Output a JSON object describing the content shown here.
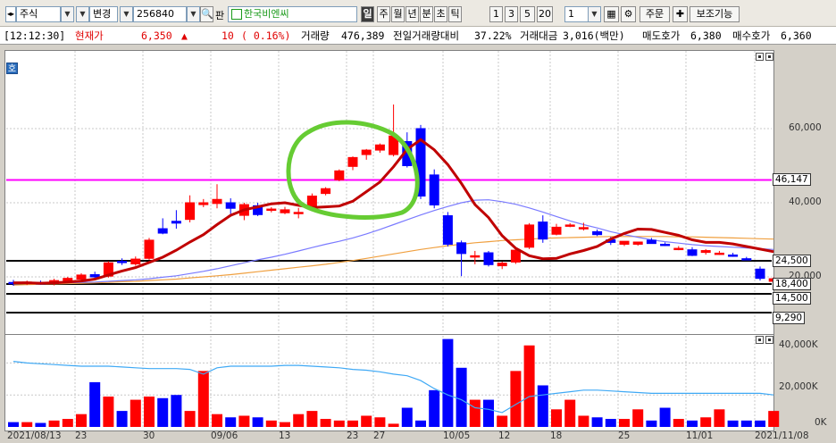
{
  "toolbar": {
    "market_type": "주식",
    "change_label": "변경",
    "stock_code": "256840",
    "board_label": "판",
    "stock_name": "한국비엔씨",
    "periods": [
      "일",
      "주",
      "월",
      "년",
      "분",
      "초",
      "틱"
    ],
    "active_period": "일",
    "intervals": [
      "1",
      "3",
      "5",
      "20"
    ],
    "interval_value": "1",
    "order_label": "주문",
    "aux_label": "보조기능"
  },
  "info": {
    "time": "[12:12:30]",
    "price_label": "현재가",
    "price": "6,350",
    "change_arrow": "▲",
    "change": "10",
    "change_pct": "( 0.16%)",
    "volume_label": "거래량",
    "volume": "476,389",
    "prev_volume_ratio_label": "전일거래량대비",
    "prev_volume_ratio": "37.22%",
    "trade_value_label": "거래대금",
    "trade_value": "3,016(백만)",
    "ask_label": "매도호가",
    "ask": "6,380",
    "bid_label": "매수호가",
    "bid": "6,360"
  },
  "chart_side_label": "호",
  "price_axis": [
    "60,000",
    "40,000",
    "20,000"
  ],
  "volume_axis": [
    "40,000K",
    "20,000K",
    "0K"
  ],
  "x_labels": [
    "2021/08/13",
    "23",
    "30",
    "09/06",
    "13",
    "23",
    "27",
    "10/05",
    "12",
    "18",
    "25",
    "11/01",
    "2021/11/08"
  ],
  "level_tags": [
    "46,147",
    "24,500",
    "18,400",
    "14,500",
    "9,290"
  ],
  "colors": {
    "up": "#ff0000",
    "down": "#0000ff",
    "ma5": "#c00000",
    "ma20": "#7a7aff",
    "ma60": "#f0a040",
    "magenta_line": "#ff00ff",
    "highlight_circle": "#66cc33",
    "vol_ma": "#3fa9f5"
  },
  "chart_data": {
    "type": "candlestick",
    "candles": [
      {
        "o": 18.5,
        "h": 19.2,
        "l": 17.6,
        "c": 18.2
      },
      {
        "o": 18.3,
        "h": 19.0,
        "l": 17.8,
        "c": 18.6
      },
      {
        "o": 18.4,
        "h": 19.0,
        "l": 17.9,
        "c": 18.1
      },
      {
        "o": 18.2,
        "h": 19.5,
        "l": 17.7,
        "c": 19.0
      },
      {
        "o": 19.0,
        "h": 20.0,
        "l": 18.6,
        "c": 19.6
      },
      {
        "o": 19.4,
        "h": 21.0,
        "l": 19.0,
        "c": 20.5
      },
      {
        "o": 20.6,
        "h": 21.4,
        "l": 19.7,
        "c": 20.0
      },
      {
        "o": 20.2,
        "h": 24.2,
        "l": 19.8,
        "c": 23.8
      },
      {
        "o": 24.2,
        "h": 25.0,
        "l": 23.2,
        "c": 24.0
      },
      {
        "o": 23.5,
        "h": 25.5,
        "l": 23.0,
        "c": 24.8
      },
      {
        "o": 25.0,
        "h": 30.5,
        "l": 24.6,
        "c": 29.9
      },
      {
        "o": 33.0,
        "h": 35.8,
        "l": 31.5,
        "c": 31.8
      },
      {
        "o": 35.0,
        "h": 38.0,
        "l": 33.0,
        "c": 34.5
      },
      {
        "o": 35.5,
        "h": 42.0,
        "l": 34.7,
        "c": 40.0
      },
      {
        "o": 39.5,
        "h": 41.0,
        "l": 38.8,
        "c": 40.0
      },
      {
        "o": 39.8,
        "h": 45.0,
        "l": 38.5,
        "c": 40.9
      },
      {
        "o": 40.0,
        "h": 41.2,
        "l": 37.0,
        "c": 38.5
      },
      {
        "o": 36.6,
        "h": 40.0,
        "l": 35.3,
        "c": 39.5
      },
      {
        "o": 39.2,
        "h": 40.0,
        "l": 36.4,
        "c": 36.8
      },
      {
        "o": 38.0,
        "h": 38.8,
        "l": 37.4,
        "c": 38.3
      },
      {
        "o": 37.3,
        "h": 38.9,
        "l": 36.9,
        "c": 38.1
      },
      {
        "o": 37.2,
        "h": 38.6,
        "l": 35.8,
        "c": 37.4
      },
      {
        "o": 38.8,
        "h": 42.5,
        "l": 38.6,
        "c": 41.8
      },
      {
        "o": 42.5,
        "h": 44.2,
        "l": 42.0,
        "c": 43.8
      },
      {
        "o": 46.2,
        "h": 49.0,
        "l": 45.8,
        "c": 48.6
      },
      {
        "o": 49.8,
        "h": 52.5,
        "l": 48.8,
        "c": 52.2
      },
      {
        "o": 53.0,
        "h": 54.5,
        "l": 51.6,
        "c": 54.2
      },
      {
        "o": 54.2,
        "h": 56.0,
        "l": 53.5,
        "c": 55.6
      },
      {
        "o": 53.0,
        "h": 66.5,
        "l": 52.5,
        "c": 58.0
      },
      {
        "o": 56.5,
        "h": 59.0,
        "l": 49.5,
        "c": 50.0
      },
      {
        "o": 60.0,
        "h": 61.0,
        "l": 41.0,
        "c": 41.8
      },
      {
        "o": 47.5,
        "h": 49.0,
        "l": 38.5,
        "c": 39.4
      },
      {
        "o": 36.5,
        "h": 37.5,
        "l": 28.2,
        "c": 28.8
      },
      {
        "o": 29.2,
        "h": 29.8,
        "l": 20.2,
        "c": 26.3
      },
      {
        "o": 25.7,
        "h": 27.0,
        "l": 23.4,
        "c": 25.7
      },
      {
        "o": 26.5,
        "h": 27.0,
        "l": 22.8,
        "c": 23.3
      },
      {
        "o": 23.0,
        "h": 24.1,
        "l": 22.1,
        "c": 23.7
      },
      {
        "o": 24.0,
        "h": 27.5,
        "l": 23.5,
        "c": 27.2
      },
      {
        "o": 28.0,
        "h": 34.5,
        "l": 27.5,
        "c": 34.0
      },
      {
        "o": 34.8,
        "h": 36.6,
        "l": 29.2,
        "c": 30.2
      },
      {
        "o": 31.5,
        "h": 34.3,
        "l": 31.2,
        "c": 33.4
      },
      {
        "o": 33.9,
        "h": 34.5,
        "l": 33.4,
        "c": 34.0
      },
      {
        "o": 33.1,
        "h": 34.6,
        "l": 32.5,
        "c": 33.3
      },
      {
        "o": 32.2,
        "h": 32.8,
        "l": 31.0,
        "c": 31.4
      },
      {
        "o": 30.0,
        "h": 30.8,
        "l": 28.6,
        "c": 29.3
      },
      {
        "o": 28.8,
        "h": 29.6,
        "l": 28.3,
        "c": 29.6
      },
      {
        "o": 28.8,
        "h": 29.5,
        "l": 28.4,
        "c": 29.4
      },
      {
        "o": 29.9,
        "h": 30.5,
        "l": 29.0,
        "c": 29.0
      },
      {
        "o": 28.8,
        "h": 29.3,
        "l": 28.3,
        "c": 28.5
      },
      {
        "o": 27.6,
        "h": 28.3,
        "l": 27.2,
        "c": 27.7
      },
      {
        "o": 27.3,
        "h": 28.0,
        "l": 25.6,
        "c": 25.8
      },
      {
        "o": 26.6,
        "h": 27.5,
        "l": 26.0,
        "c": 27.1
      },
      {
        "o": 26.4,
        "h": 27.0,
        "l": 25.9,
        "c": 26.4
      },
      {
        "o": 25.9,
        "h": 26.5,
        "l": 25.4,
        "c": 25.6
      },
      {
        "o": 24.9,
        "h": 25.4,
        "l": 24.5,
        "c": 24.6
      },
      {
        "o": 22.1,
        "h": 22.8,
        "l": 19.0,
        "c": 19.6
      },
      {
        "o": 18.8,
        "h": 19.9,
        "l": 18.0,
        "c": 19.5
      }
    ],
    "volumes": [
      3,
      3,
      2.5,
      4,
      5,
      8,
      28,
      19,
      10,
      17,
      19,
      18,
      20,
      10,
      35,
      8,
      6,
      7,
      6,
      4,
      3,
      8,
      10,
      5,
      4,
      4,
      7,
      6,
      2,
      12,
      4,
      23,
      55,
      37,
      17,
      17,
      7,
      35,
      51,
      26,
      11,
      17,
      7,
      6,
      5,
      5,
      11,
      4,
      12,
      5,
      4,
      6,
      11,
      4,
      4,
      4,
      10
    ],
    "price_ylim": [
      17.0,
      68.0
    ],
    "volume_ylim": [
      0,
      57
    ],
    "ma5": [
      18.4,
      18.4,
      18.3,
      18.4,
      18.6,
      18.9,
      19.4,
      20.5,
      21.6,
      22.5,
      23.9,
      25.3,
      27.2,
      29.4,
      31.4,
      34.1,
      36.6,
      38.1,
      38.9,
      39.7,
      40.0,
      39.3,
      38.7,
      38.9,
      39.1,
      40.4,
      43.0,
      45.6,
      49.7,
      54.4,
      57.0,
      54.3,
      50.3,
      45.2,
      39.5,
      36.0,
      31.1,
      27.7,
      25.7,
      24.9,
      25.0,
      26.2,
      27.1,
      28.2,
      30.2,
      31.7,
      32.9,
      32.8,
      32.0,
      31.2,
      30.0,
      29.3,
      29.3,
      28.9,
      28.2,
      27.5,
      26.8
    ],
    "ma20": [
      18.3,
      18.3,
      18.3,
      18.3,
      18.4,
      18.5,
      18.6,
      18.8,
      19.0,
      19.2,
      19.5,
      19.9,
      20.3,
      20.9,
      21.5,
      22.2,
      23.0,
      23.8,
      24.6,
      25.3,
      26.1,
      27.0,
      27.9,
      28.8,
      29.6,
      30.5,
      31.6,
      32.8,
      34.1,
      35.4,
      36.7,
      37.9,
      39.0,
      40.0,
      40.7,
      40.8,
      40.3,
      39.6,
      38.6,
      37.5,
      36.3,
      35.1,
      34.1,
      33.2,
      32.2,
      31.4,
      30.7,
      30.0,
      29.5,
      29.1,
      28.7,
      28.4,
      28.2,
      28.0,
      27.8,
      27.6,
      27.4
    ],
    "ma60": [
      17.8,
      17.9,
      18.0,
      18.1,
      18.2,
      18.3,
      18.4,
      18.5,
      18.7,
      18.8,
      19.0,
      19.2,
      19.4,
      19.7,
      20.0,
      20.3,
      20.6,
      21.0,
      21.4,
      21.8,
      22.2,
      22.6,
      23.0,
      23.4,
      23.9,
      24.4,
      25.0,
      25.6,
      26.2,
      26.8,
      27.4,
      27.9,
      28.4,
      28.8,
      29.2,
      29.5,
      29.8,
      30.0,
      30.2,
      30.4,
      30.5,
      30.6,
      30.7,
      30.8,
      30.9,
      30.9,
      30.9,
      30.9,
      30.9,
      30.8,
      30.8,
      30.7,
      30.6,
      30.5,
      30.4,
      30.3,
      30.2
    ],
    "vol_ma": [
      41,
      40,
      39.5,
      39,
      38.5,
      38,
      38,
      38,
      37.5,
      37,
      36.5,
      36.5,
      36.5,
      36,
      33,
      37,
      38,
      38,
      38,
      38,
      38.5,
      38.5,
      38,
      37.5,
      37,
      36,
      35.5,
      34.5,
      33,
      32,
      29,
      24,
      20,
      17,
      12,
      11,
      9,
      14,
      19,
      20,
      21,
      22,
      23,
      23,
      22.5,
      22,
      21.5,
      21,
      21,
      21,
      21,
      21,
      21,
      21,
      21,
      21,
      20
    ],
    "levels": {
      "magenta": 46.147,
      "black": [
        24.5,
        18.4,
        14.5,
        9.29
      ]
    }
  }
}
